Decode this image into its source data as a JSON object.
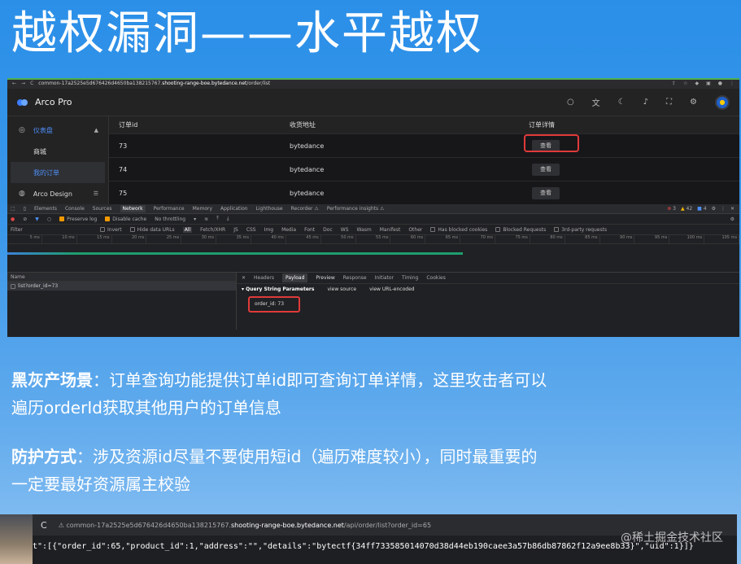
{
  "slide": {
    "title": "越权漏洞——水平越权",
    "scenario_label": "黑灰产场景",
    "scenario_line1": "：订单查询功能提供订单id即可查询订单详情，这里攻击者可以",
    "scenario_line2": "遍历orderId获取其他用户的订单信息",
    "protect_label": "防护方式",
    "protect_line1": "：涉及资源id尽量不要使用短id（遍历难度较小），同时最重要的",
    "protect_line2": "一定要最好资源属主校验"
  },
  "browser1": {
    "url_prefix": "common-17a2525e5d676426d4650ba138215767.",
    "url_host": "shooting-range-boe.bytedance.net",
    "url_path": "/order/list",
    "app": {
      "brand": "Arco Pro",
      "sidebar": [
        {
          "label": "仪表盘"
        },
        {
          "label": "商城"
        },
        {
          "label": "我的订单"
        },
        {
          "label": "Arco Design"
        }
      ],
      "columns": [
        "订单id",
        "收货地址",
        "订单详情"
      ],
      "rows": [
        {
          "id": "73",
          "address": "bytedance",
          "action": "查看"
        },
        {
          "id": "74",
          "address": "bytedance",
          "action": "查看"
        },
        {
          "id": "75",
          "address": "bytedance",
          "action": "查看"
        }
      ]
    },
    "devtools": {
      "tabs": [
        "Elements",
        "Console",
        "Sources",
        "Network",
        "Performance",
        "Memory",
        "Application",
        "Lighthouse",
        "Recorder ⚠",
        "Performance insights ⚠"
      ],
      "status": {
        "errors": "3",
        "warnings": "42",
        "info": "4"
      },
      "toolbar": {
        "preserve_log": "Preserve log",
        "disable_cache": "Disable cache",
        "throttling": "No throttling"
      },
      "filter": {
        "label": "Filter",
        "invert": "Invert",
        "hide_data_urls": "Hide data URLs",
        "types": [
          "All",
          "Fetch/XHR",
          "JS",
          "CSS",
          "Img",
          "Media",
          "Font",
          "Doc",
          "WS",
          "Wasm",
          "Manifest",
          "Other"
        ],
        "blocked_cookies": "Has blocked cookies",
        "blocked_requests": "Blocked Requests",
        "third_party": "3rd-party requests"
      },
      "ticks": [
        "5 ms",
        "10 ms",
        "15 ms",
        "20 ms",
        "25 ms",
        "30 ms",
        "35 ms",
        "40 ms",
        "45 ms",
        "50 ms",
        "55 ms",
        "60 ms",
        "65 ms",
        "70 ms",
        "75 ms",
        "80 ms",
        "85 ms",
        "90 ms",
        "95 ms",
        "100 ms",
        "105 ms"
      ],
      "name_header": "Name",
      "request": "list?order_id=73",
      "detail_tabs": [
        "Headers",
        "Payload",
        "Preview",
        "Response",
        "Initiator",
        "Timing",
        "Cookies"
      ],
      "qs_title": "▾ Query String Parameters",
      "view_source": "view source",
      "view_url_encoded": "view URL-encoded",
      "param": "order_id: 73"
    }
  },
  "browser2": {
    "url_prefix": "common-17a2525e5d676426d4650ba138215767.",
    "url_host": "shooting-range-boe.bytedance.net",
    "url_path": "/api/order/list?order_id=65",
    "body": "t\":[{\"order_id\":65,\"product_id\":1,\"address\":\"\",\"details\":\"bytectf{34ff733585014070d38d44eb190caee3a57b86db87862f12a9ee8b33}\",\"uid\":1}]}"
  },
  "watermark": "@稀土掘金技术社区"
}
